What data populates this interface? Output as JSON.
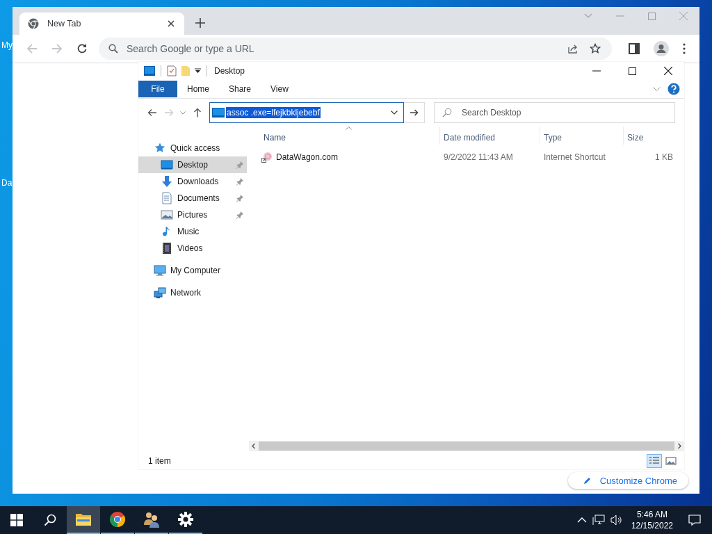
{
  "desktop": {
    "icon_labels": [
      "My",
      "Da"
    ]
  },
  "browser": {
    "tab": {
      "title": "New Tab"
    },
    "back_disabled": true,
    "forward_disabled": true,
    "omnibox": {
      "placeholder": "Search Google or type a URL"
    },
    "customize_button": "Customize Chrome"
  },
  "explorer": {
    "title": "Desktop",
    "ribbon_tabs": [
      {
        "label": "File",
        "kind": "file"
      },
      {
        "label": "Home",
        "kind": "tab"
      },
      {
        "label": "Share",
        "kind": "tab"
      },
      {
        "label": "View",
        "kind": "tab"
      }
    ],
    "forward_disabled": true,
    "address": {
      "value": "assoc .exe=lfejkbkljebebf",
      "text_selected": true
    },
    "search": {
      "placeholder": "Search Desktop"
    },
    "nav": [
      {
        "label": "Quick access",
        "kind": "star",
        "selected": false,
        "children": [
          {
            "label": "Desktop",
            "kind": "desktop",
            "selected": true,
            "pinned": true
          },
          {
            "label": "Downloads",
            "kind": "download",
            "selected": false,
            "pinned": true
          },
          {
            "label": "Documents",
            "kind": "document",
            "selected": false,
            "pinned": true
          },
          {
            "label": "Pictures",
            "kind": "pictures",
            "selected": false,
            "pinned": true
          },
          {
            "label": "Music",
            "kind": "music",
            "selected": false,
            "pinned": false
          },
          {
            "label": "Videos",
            "kind": "videos",
            "selected": false,
            "pinned": false
          }
        ]
      },
      {
        "label": "My Computer",
        "kind": "computer",
        "selected": false
      },
      {
        "label": "Network",
        "kind": "network",
        "selected": false
      }
    ],
    "columns": [
      {
        "label": "Name",
        "sorted": true
      },
      {
        "label": "Date modified",
        "sorted": false
      },
      {
        "label": "Type",
        "sorted": false
      },
      {
        "label": "Size",
        "sorted": false
      }
    ],
    "rows": [
      {
        "name": "DataWagon.com",
        "date_modified": "9/2/2022 11:43 AM",
        "type": "Internet Shortcut",
        "size": "1 KB"
      }
    ],
    "status": "1 item",
    "view_modes": [
      {
        "kind": "details",
        "selected": true
      },
      {
        "kind": "large_icons",
        "selected": false
      }
    ]
  },
  "taskbar": {
    "apps": [
      {
        "kind": "explorer",
        "active": true,
        "open": true
      },
      {
        "kind": "chrome",
        "active": false,
        "open": true
      },
      {
        "kind": "people",
        "active": false,
        "open": true
      },
      {
        "kind": "settings",
        "active": false,
        "open": true
      }
    ],
    "clock": {
      "time": "5:46 AM",
      "date": "12/15/2022"
    }
  }
}
